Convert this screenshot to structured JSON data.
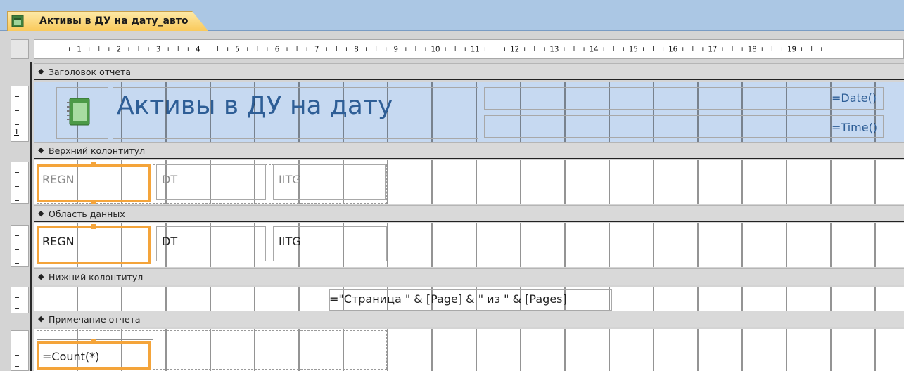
{
  "tab": {
    "title": "Активы в ДУ на дату_авто",
    "icon": "report-icon"
  },
  "ruler": {
    "labels": [
      "1",
      "2",
      "3",
      "4",
      "5",
      "6",
      "7",
      "8",
      "9",
      "10",
      "11",
      "12",
      "13",
      "14",
      "15",
      "16",
      "17",
      "18",
      "19"
    ]
  },
  "vruler": {
    "header_number": "1"
  },
  "sections": {
    "report_header": "Заголовок отчета",
    "page_header": "Верхний колонтитул",
    "detail": "Область данных",
    "page_footer": "Нижний колонтитул",
    "report_footer": "Примечание отчета"
  },
  "header_controls": {
    "title": "Активы в ДУ на дату",
    "date": "=Date()",
    "time": "=Time()"
  },
  "page_header_labels": {
    "regn": "REGN",
    "dt": "DT",
    "iitg": "IITG"
  },
  "detail_fields": {
    "regn": "REGN",
    "dt": "DT",
    "iitg": "IITG"
  },
  "footer_expression": "=\"Страница \" & [Page] & \" из \" & [Pages]",
  "report_footer_expression": "=Count(*)",
  "colors": {
    "tab": "#f9c95a",
    "header_bg": "#c6d9f1",
    "selection": "#f4a43a",
    "title_text": "#2e5e96"
  }
}
